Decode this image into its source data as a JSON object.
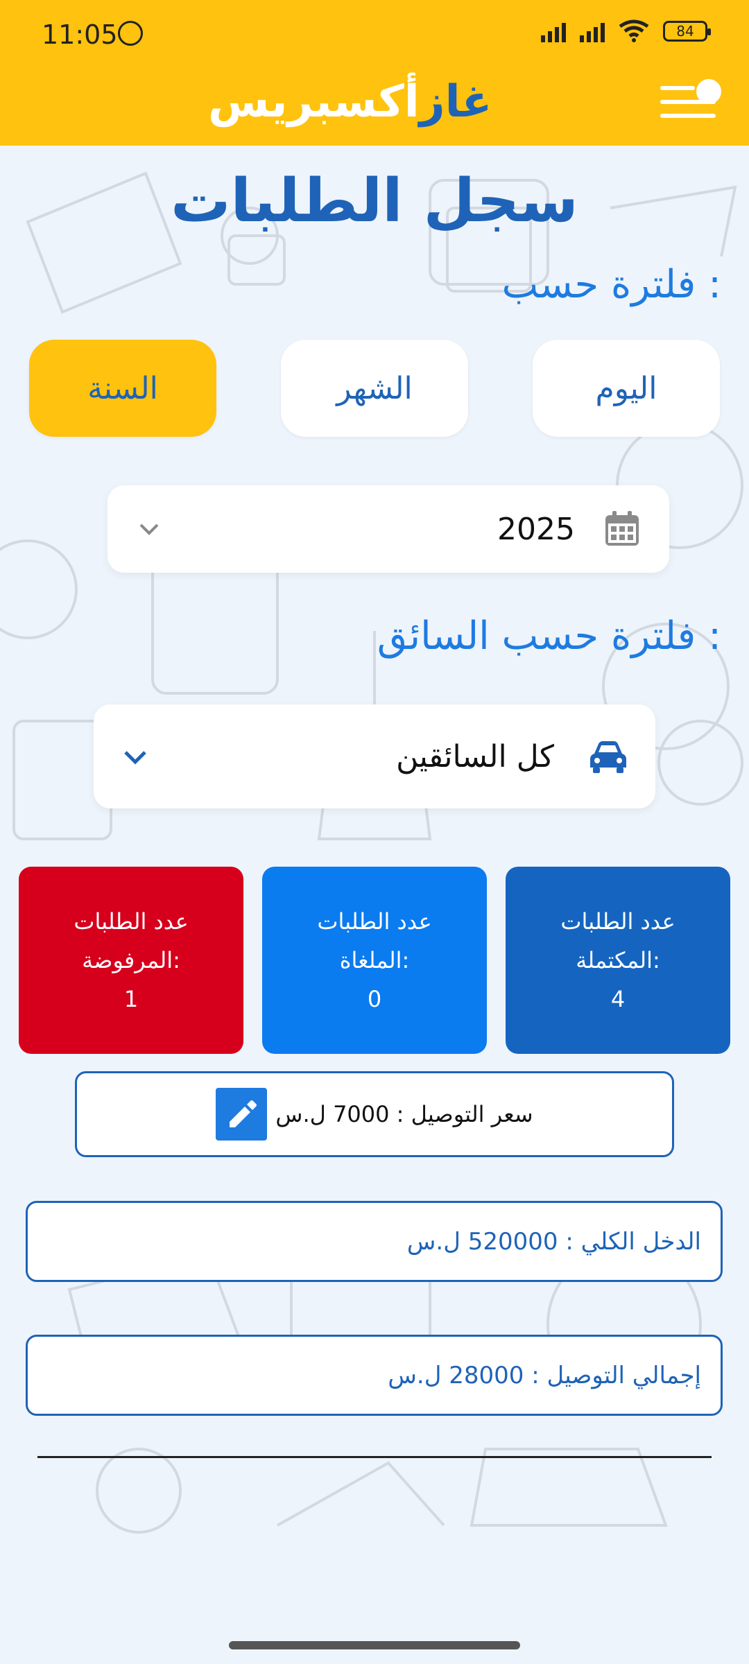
{
  "status": {
    "time": "11:05",
    "battery": "84"
  },
  "app": {
    "brand_part1": "غاز",
    "brand_part2": "أكسبريس"
  },
  "page": {
    "title": "سجل الطلبات"
  },
  "filters": {
    "label": "فلترة حسب :",
    "options": [
      "اليوم",
      "الشهر",
      "السنة"
    ],
    "selected": "السنة",
    "year_value": "2025"
  },
  "driver_filter": {
    "label": "فلترة حسب السائق :",
    "value": "كل السائقين"
  },
  "stats": [
    {
      "line1": "عدد الطلبات",
      "line2": "المكتملة:",
      "value": "4",
      "color": "#1565c0"
    },
    {
      "line1": "عدد الطلبات",
      "line2": "الملغاة:",
      "value": "0",
      "color": "#0b7bf0"
    },
    {
      "line1": "عدد الطلبات",
      "line2": "المرفوضة:",
      "value": "1",
      "color": "#d6001c"
    }
  ],
  "delivery_price": "سعر التوصيل : 7000 ل.س",
  "total_income": "الدخل الكلي : 520000 ل.س",
  "total_delivery": "إجمالي التوصيل : 28000 ل.س",
  "colors": {
    "accent": "#ffc20e",
    "primary": "#1e63b7",
    "link": "#1e7be0"
  }
}
